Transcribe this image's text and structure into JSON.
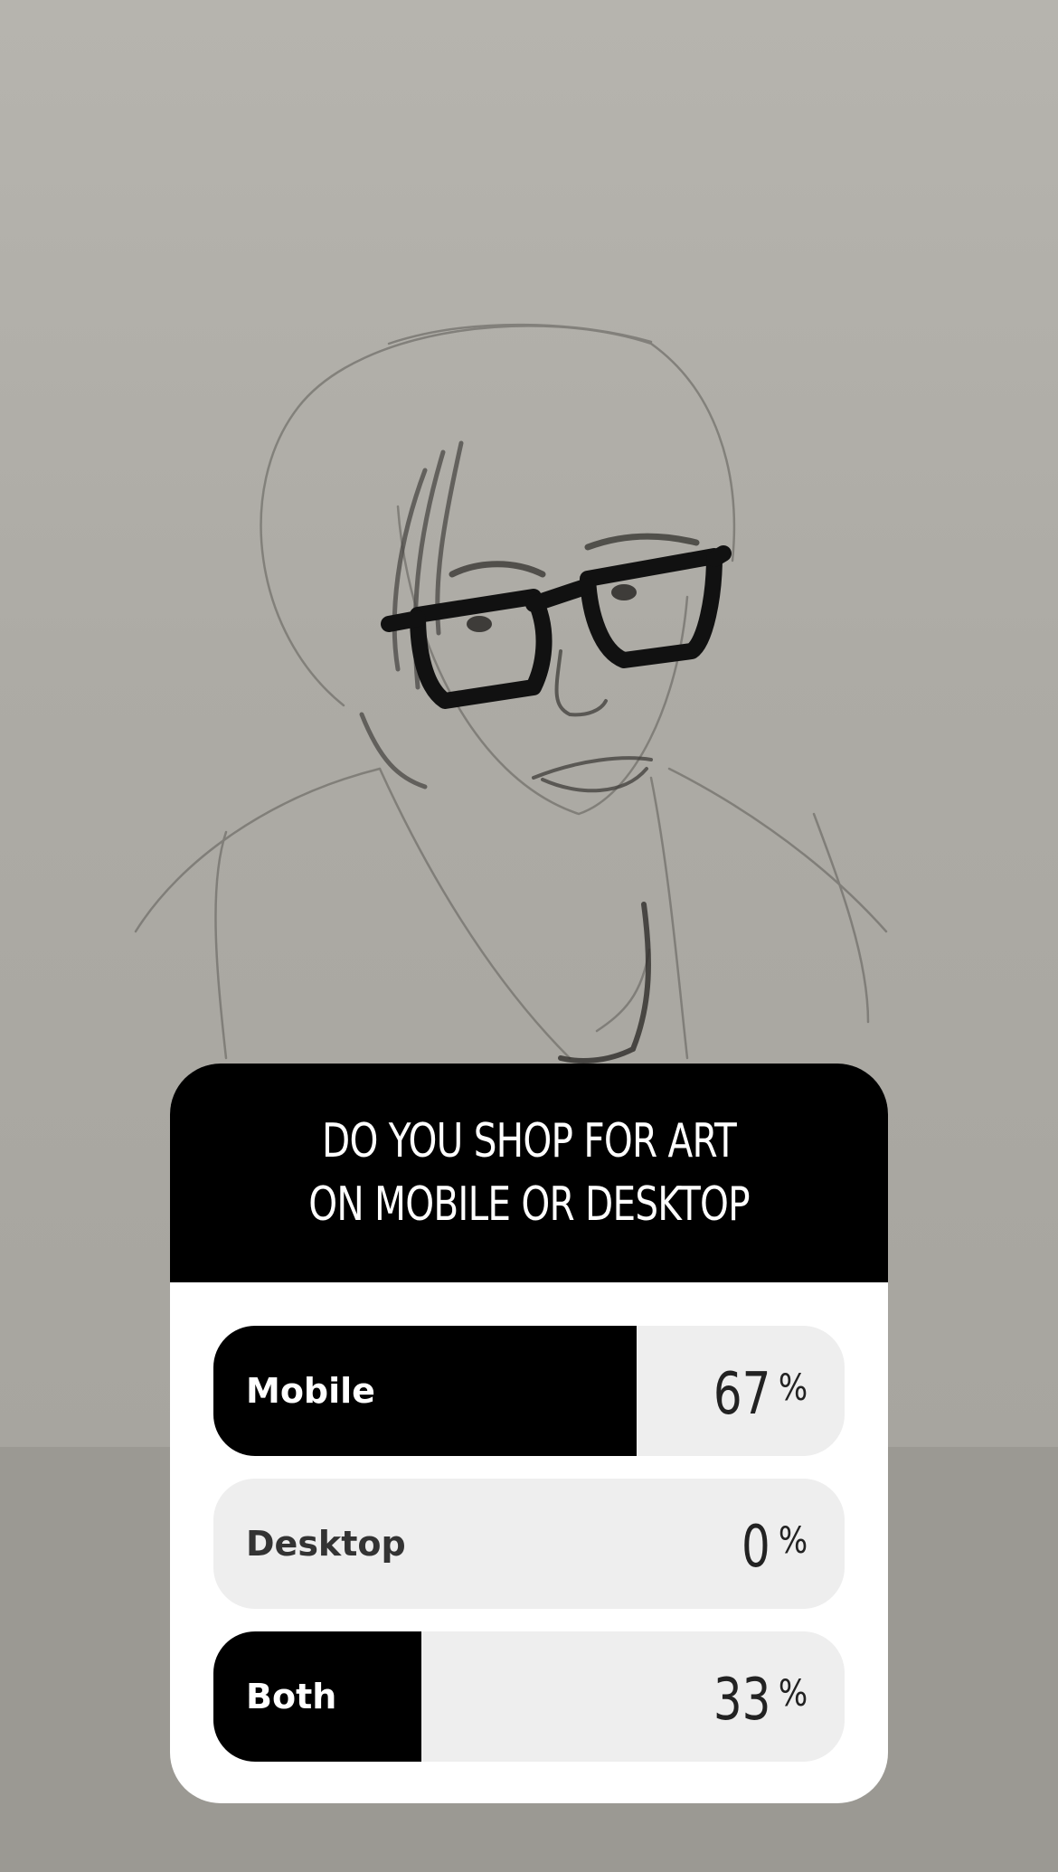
{
  "poll": {
    "question": "DO YOU SHOP FOR ART ON MOBILE OR DESKTOP",
    "options": [
      {
        "label": "Mobile",
        "percent": "67",
        "percent_sign": "%",
        "fraction": 0.67
      },
      {
        "label": "Desktop",
        "percent": "0",
        "percent_sign": "%",
        "fraction": 0.0
      },
      {
        "label": "Both",
        "percent": "33",
        "percent_sign": "%",
        "fraction": 0.33
      }
    ]
  },
  "colors": {
    "bar_fill": "#000000",
    "bar_track": "#eeeeee",
    "header_background": "#000000",
    "card_background": "#ffffff"
  },
  "background": {
    "subject": "pencil-sketch-portrait"
  }
}
